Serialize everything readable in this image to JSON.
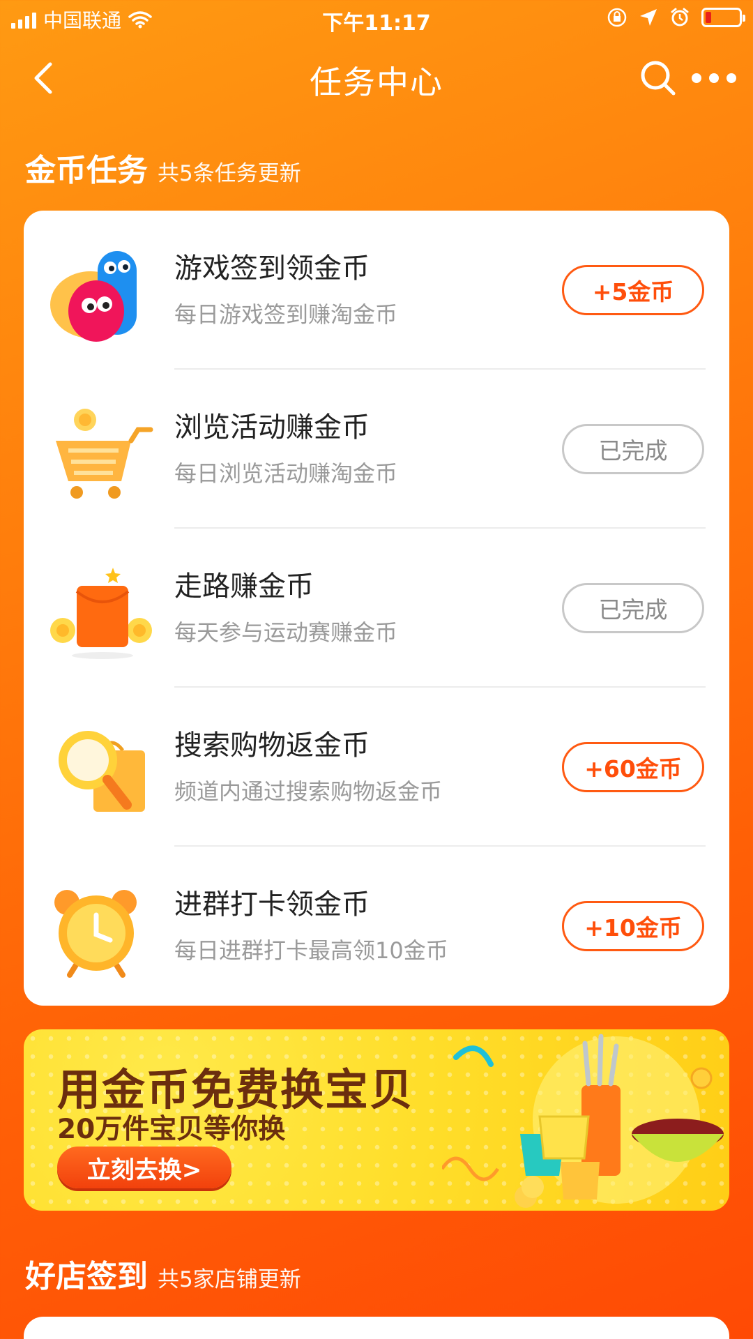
{
  "status_bar": {
    "carrier": "中国联通",
    "time": "下午11:17"
  },
  "nav": {
    "title": "任务中心"
  },
  "coin_tasks": {
    "title": "金币任务",
    "subtitle": "共5条任务更新",
    "items": [
      {
        "title": "游戏签到领金币",
        "desc": "每日游戏签到赚淘金币",
        "action": "+5金币",
        "icon": "game-characters-icon"
      },
      {
        "title": "浏览活动赚金币",
        "desc": "每日浏览活动赚淘金币",
        "action": "已完成",
        "icon": "shopping-cart-icon"
      },
      {
        "title": "走路赚金币",
        "desc": "每天参与运动赛赚金币",
        "action": "已完成",
        "icon": "red-envelope-icon"
      },
      {
        "title": "搜索购物返金币",
        "desc": "频道内通过搜索购物返金币",
        "action": "+60金币",
        "icon": "magnifier-bag-icon"
      },
      {
        "title": "进群打卡领金币",
        "desc": "每日进群打卡最高领10金币",
        "action": "+10金币",
        "icon": "alarm-clock-icon"
      }
    ]
  },
  "banner": {
    "title": "用金币免费换宝贝",
    "subtitle": "20万件宝贝等你换",
    "button": "立刻去换>"
  },
  "shop_checkin": {
    "title": "好店签到",
    "subtitle": "共5家店铺更新"
  },
  "colors": {
    "accent": "#ff5a12",
    "background_start": "#ff9a12",
    "background_end": "#ff4a05"
  }
}
